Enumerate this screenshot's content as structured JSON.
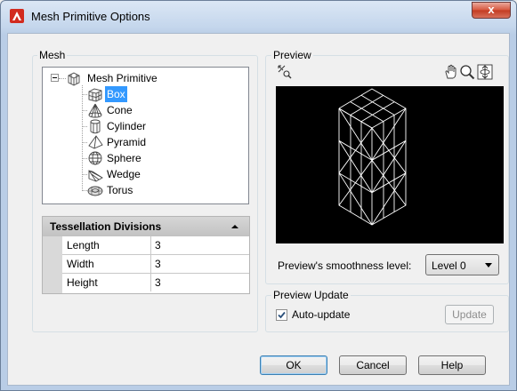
{
  "window": {
    "title": "Mesh Primitive Options",
    "close_glyph": "x"
  },
  "mesh_group": {
    "label": "Mesh",
    "tree": {
      "root_label": "Mesh Primitive",
      "items": [
        {
          "label": "Box",
          "icon": "box-icon",
          "selected": true
        },
        {
          "label": "Cone",
          "icon": "cone-icon"
        },
        {
          "label": "Cylinder",
          "icon": "cylinder-icon"
        },
        {
          "label": "Pyramid",
          "icon": "pyramid-icon"
        },
        {
          "label": "Sphere",
          "icon": "sphere-icon"
        },
        {
          "label": "Wedge",
          "icon": "wedge-icon"
        },
        {
          "label": "Torus",
          "icon": "torus-icon"
        }
      ]
    },
    "tessellation": {
      "header": "Tessellation Divisions",
      "rows": [
        {
          "name": "Length",
          "value": "3"
        },
        {
          "name": "Width",
          "value": "3"
        },
        {
          "name": "Height",
          "value": "3"
        }
      ]
    }
  },
  "preview_group": {
    "label": "Preview",
    "smoothness_label": "Preview's smoothness level:",
    "smoothness_value": "Level 0",
    "viewport_background": "#000000",
    "wireframe_color": "#ffffff"
  },
  "preview_update_group": {
    "label": "Preview Update",
    "auto_update_label": "Auto-update",
    "auto_update_checked": true,
    "update_button": "Update"
  },
  "buttons": {
    "ok": "OK",
    "cancel": "Cancel",
    "help": "Help"
  },
  "colors": {
    "selection": "#3399ff",
    "close_button": "#c23b21",
    "app_icon": "#d22b1f"
  }
}
